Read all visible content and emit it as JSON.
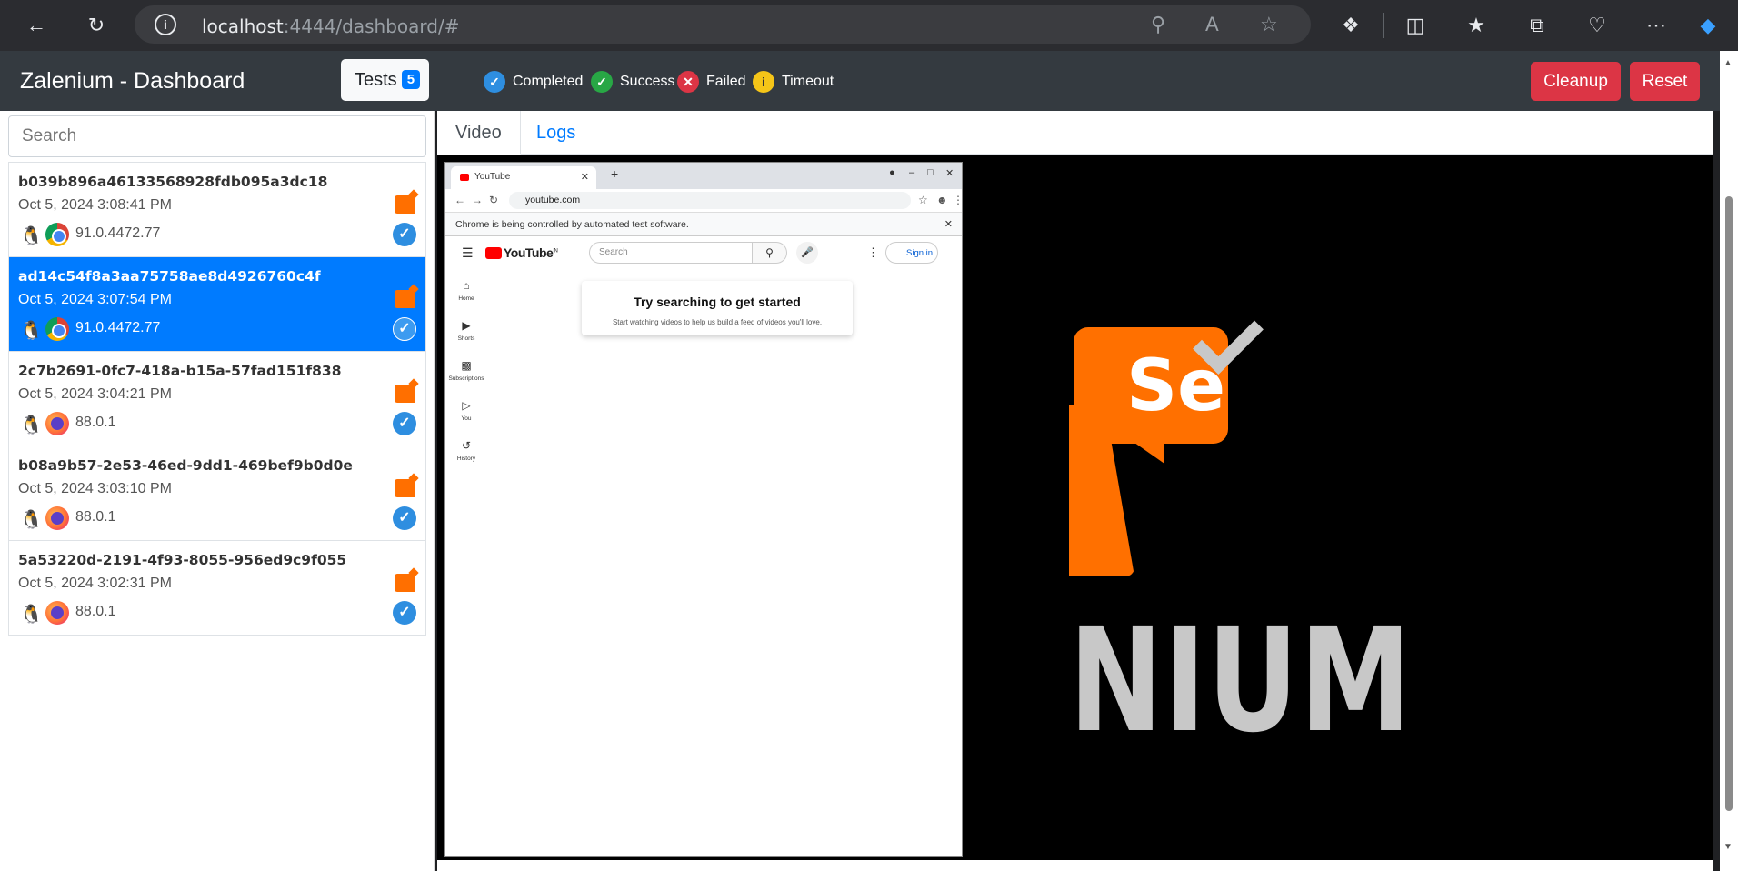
{
  "browser": {
    "url_host": "localhost",
    "url_rest": ":4444/dashboard/#"
  },
  "header": {
    "title": "Zalenium - Dashboard",
    "tests_label": "Tests",
    "tests_count": "5",
    "legend": {
      "completed": "Completed",
      "success": "Success",
      "failed": "Failed",
      "timeout": "Timeout"
    },
    "cleanup_label": "Cleanup",
    "reset_label": "Reset",
    "colors": {
      "completed": "#2e8ee0",
      "success": "#28a745",
      "failed": "#dc3545",
      "timeout": "#f5c518",
      "danger": "#dc3545",
      "primary": "#007bff"
    }
  },
  "sidebar": {
    "search_placeholder": "Search",
    "tests": [
      {
        "id": "b039b896a46133568928fdb095a3dc18",
        "date": "Oct 5, 2024 3:08:41 PM",
        "browser": "chrome",
        "version": "91.0.4472.77"
      },
      {
        "id": "ad14c54f8a3aa75758ae8d4926760c4f",
        "date": "Oct 5, 2024 3:07:54 PM",
        "browser": "chrome",
        "version": "91.0.4472.77"
      },
      {
        "id": "2c7b2691-0fc7-418a-b15a-57fad151f838",
        "date": "Oct 5, 2024 3:04:21 PM",
        "browser": "firefox",
        "version": "88.0.1"
      },
      {
        "id": "b08a9b57-2e53-46ed-9dd1-469bef9b0d0e",
        "date": "Oct 5, 2024 3:03:10 PM",
        "browser": "firefox",
        "version": "88.0.1"
      },
      {
        "id": "5a53220d-2191-4f93-8055-956ed9c9f055",
        "date": "Oct 5, 2024 3:02:31 PM",
        "browser": "firefox",
        "version": "88.0.1"
      }
    ]
  },
  "main": {
    "tabs": {
      "video": "Video",
      "logs": "Logs"
    },
    "video": {
      "logo_text": "NIUM",
      "logo_se": "Se",
      "window": {
        "tab_title": "YouTube",
        "url": "youtube.com",
        "info_bar": "Chrome is being controlled by automated test software.",
        "yt_logo": "YouTube",
        "yt_region": "IN",
        "yt_search_placeholder": "Search",
        "yt_signin": "Sign in",
        "nav": [
          "Home",
          "Shorts",
          "Subscriptions",
          "You",
          "History"
        ],
        "card_title": "Try searching to get started",
        "card_sub": "Start watching videos to help us build a feed of videos you'll love."
      }
    }
  }
}
